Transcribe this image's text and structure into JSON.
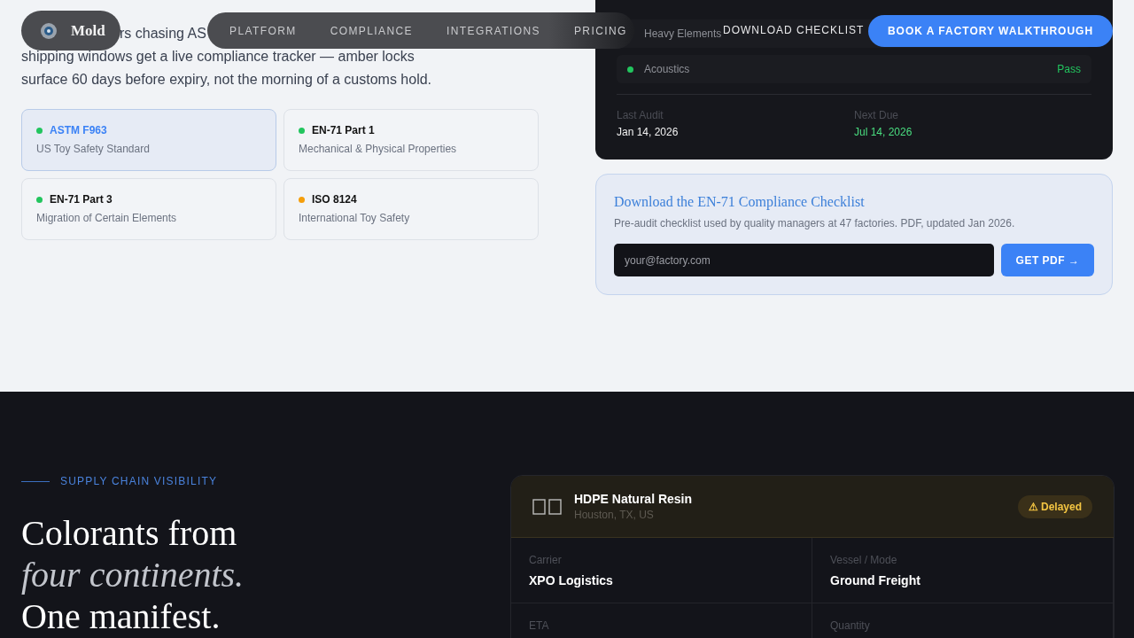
{
  "nav": {
    "logo": "Mold",
    "links": [
      {
        "label": "PLATFORM"
      },
      {
        "label": "COMPLIANCE"
      },
      {
        "label": "INTEGRATIONS"
      },
      {
        "label": "PRICING"
      }
    ],
    "secondary": "DOWNLOAD CHECKLIST",
    "cta": "BOOK A FACTORY WALKTHROUGH"
  },
  "intro": {
    "lines": [
      "rs chasing AS",
      "shipping windows get a live compliance tracker — amber locks",
      "surface 60 days before expiry, not the morning of a customs hold."
    ]
  },
  "standards": [
    {
      "code": "ASTM F963",
      "desc": "US Toy Safety Standard",
      "selected": true,
      "color": "#22c55e"
    },
    {
      "code": "EN-71 Part 1",
      "desc": "Mechanical & Physical Properties",
      "selected": false,
      "color": "#22c55e"
    },
    {
      "code": "EN-71 Part 3",
      "desc": "Migration of Certain Elements",
      "selected": false,
      "color": "#22c55e"
    },
    {
      "code": "ISO 8124",
      "desc": "International Toy Safety",
      "selected": false,
      "color": "#f59e0b"
    }
  ],
  "audit": {
    "checks": [
      {
        "name": "Heavy Elements"
      },
      {
        "name": "Acoustics",
        "status": "Pass",
        "color": "#22c55e"
      }
    ],
    "last_label": "Last Audit",
    "last_value": "Jan 14, 2026",
    "next_label": "Next Due",
    "next_value": "Jul 14, 2026"
  },
  "checklist": {
    "title": "Download the EN-71 Compliance Checklist",
    "desc": "Pre-audit checklist used by quality managers at 47 factories. PDF, updated Jan 2026.",
    "placeholder": "your@factory.com",
    "button": "GET PDF →"
  },
  "supply": {
    "eyebrow": "SUPPLY CHAIN VISIBILITY",
    "headline": [
      "Colorants from",
      "four continents.",
      "One manifest."
    ]
  },
  "shipment": {
    "name": "HDPE Natural Resin",
    "origin": "Houston, TX, US",
    "status": "⚠ Delayed",
    "fields": [
      {
        "label": "Carrier",
        "value": "XPO Logistics"
      },
      {
        "label": "Vessel / Mode",
        "value": "Ground Freight"
      },
      {
        "label": "ETA"
      },
      {
        "label": "Quantity"
      }
    ]
  }
}
